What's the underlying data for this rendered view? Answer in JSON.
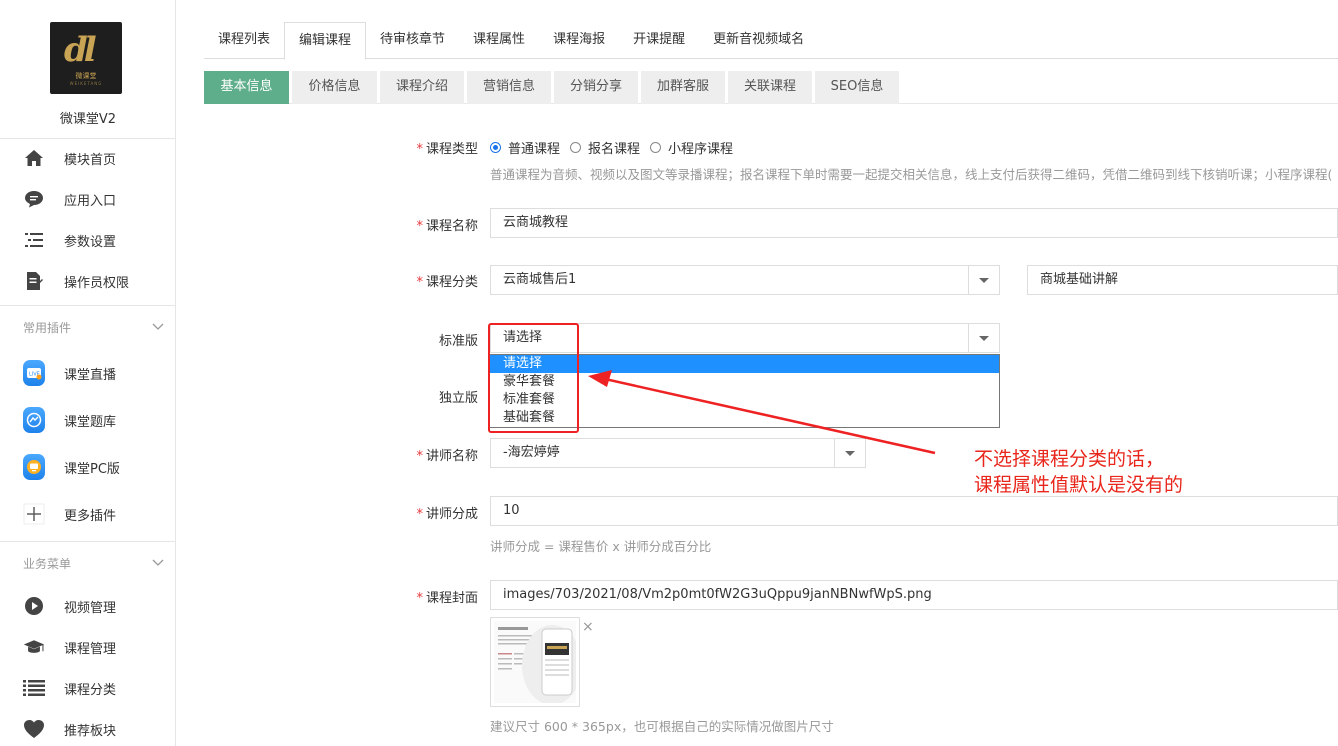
{
  "sidebar": {
    "app_name": "微课堂V2",
    "logo_text": "微课堂",
    "main_items": [
      {
        "label": "模块首页",
        "icon": "home-icon"
      },
      {
        "label": "应用入口",
        "icon": "chat-bubble-icon"
      },
      {
        "label": "参数设置",
        "icon": "list-settings-icon"
      },
      {
        "label": "操作员权限",
        "icon": "edit-document-icon"
      }
    ],
    "plugins_title": "常用插件",
    "plugin_items": [
      {
        "label": "课堂直播",
        "icon": "live-tv-icon"
      },
      {
        "label": "课堂题库",
        "icon": "question-bank-icon"
      },
      {
        "label": "课堂PC版",
        "icon": "pc-monitor-icon"
      },
      {
        "label": "更多插件",
        "icon": "plus-icon"
      }
    ],
    "business_title": "业务菜单",
    "business_items": [
      {
        "label": "视频管理",
        "icon": "play-circle-icon"
      },
      {
        "label": "课程管理",
        "icon": "graduation-cap-icon"
      },
      {
        "label": "课程分类",
        "icon": "list-icon"
      },
      {
        "label": "推荐板块",
        "icon": "heart-icon"
      }
    ]
  },
  "top_tabs": [
    "课程列表",
    "编辑课程",
    "待审核章节",
    "课程属性",
    "课程海报",
    "开课提醒",
    "更新音视频域名"
  ],
  "top_tab_active": "编辑课程",
  "sub_tabs": [
    "基本信息",
    "价格信息",
    "课程介绍",
    "营销信息",
    "分销分享",
    "加群客服",
    "关联课程",
    "SEO信息"
  ],
  "sub_tab_active": "基本信息",
  "form": {
    "course_type": {
      "label": "课程类型",
      "options": [
        "普通课程",
        "报名课程",
        "小程序课程"
      ],
      "selected": "普通课程",
      "hint": "普通课程为音频、视频以及图文等录播课程；报名课程下单时需要一起提交相关信息，线上支付后获得二维码，凭借二维码到线下核销听课；小程序课程("
    },
    "course_name": {
      "label": "课程名称",
      "value": "云商城教程"
    },
    "course_category": {
      "label": "课程分类",
      "value": "云商城售后1",
      "value2": "商城基础讲解"
    },
    "standard": {
      "label": "标准版",
      "value": "请选择",
      "options": [
        "请选择",
        "豪华套餐",
        "标准套餐",
        "基础套餐"
      ],
      "highlighted": "请选择"
    },
    "independent": {
      "label": "独立版"
    },
    "teacher_name": {
      "label": "讲师名称",
      "value": "-海宏婷婷"
    },
    "teacher_share": {
      "label": "讲师分成",
      "value": "10",
      "hint": "讲师分成 = 课程售价 x 讲师分成百分比"
    },
    "course_cover": {
      "label": "课程封面",
      "value": "images/703/2021/08/Vm2p0mt0fW2G3uQppu9janNBNwfWpS.png",
      "hint": "建议尺寸 600 * 365px，也可根据自己的实际情况做图片尺寸",
      "remove": "×"
    }
  },
  "annotation": {
    "line1": "不选择课程分类的话，",
    "line2": "课程属性值默认是没有的",
    "color": "#e8261b"
  },
  "colors": {
    "accent_green": "#5fae8b",
    "radio_blue": "#1a73e8",
    "dropdown_highlight": "#1e90ff",
    "required": "#e4393c"
  }
}
